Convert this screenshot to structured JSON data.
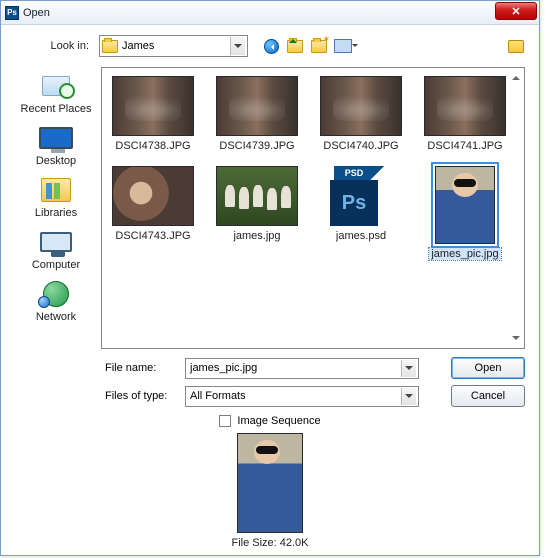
{
  "titlebar": {
    "title": "Open",
    "app_icon": "Ps"
  },
  "lookin": {
    "label": "Look in:",
    "folder": "James"
  },
  "nav": {
    "back": "back-icon",
    "up": "up-one-level-icon",
    "new_folder": "new-folder-icon",
    "view": "view-menu-icon",
    "favorites": "favorites-icon"
  },
  "sidebar": {
    "items": [
      {
        "label": "Recent Places"
      },
      {
        "label": "Desktop"
      },
      {
        "label": "Libraries"
      },
      {
        "label": "Computer"
      },
      {
        "label": "Network"
      }
    ]
  },
  "files": {
    "items": [
      {
        "label": "DSCI4738.JPG"
      },
      {
        "label": "DSCI4739.JPG"
      },
      {
        "label": "DSCI4740.JPG"
      },
      {
        "label": "DSCI4741.JPG"
      },
      {
        "label": "DSCI4743.JPG"
      },
      {
        "label": "james.jpg"
      },
      {
        "label": "james.psd",
        "psd_badge": "PSD",
        "psd_text": "Ps"
      },
      {
        "label": "james_pic.jpg",
        "selected": true
      }
    ]
  },
  "filename": {
    "label": "File name:",
    "value": "james_pic.jpg"
  },
  "filetype": {
    "label": "Files of type:",
    "value": "All Formats"
  },
  "buttons": {
    "open": "Open",
    "cancel": "Cancel"
  },
  "sequence": {
    "label": "Image Sequence",
    "checked": false
  },
  "preview": {
    "filesize_label": "File Size: 42.0K"
  }
}
